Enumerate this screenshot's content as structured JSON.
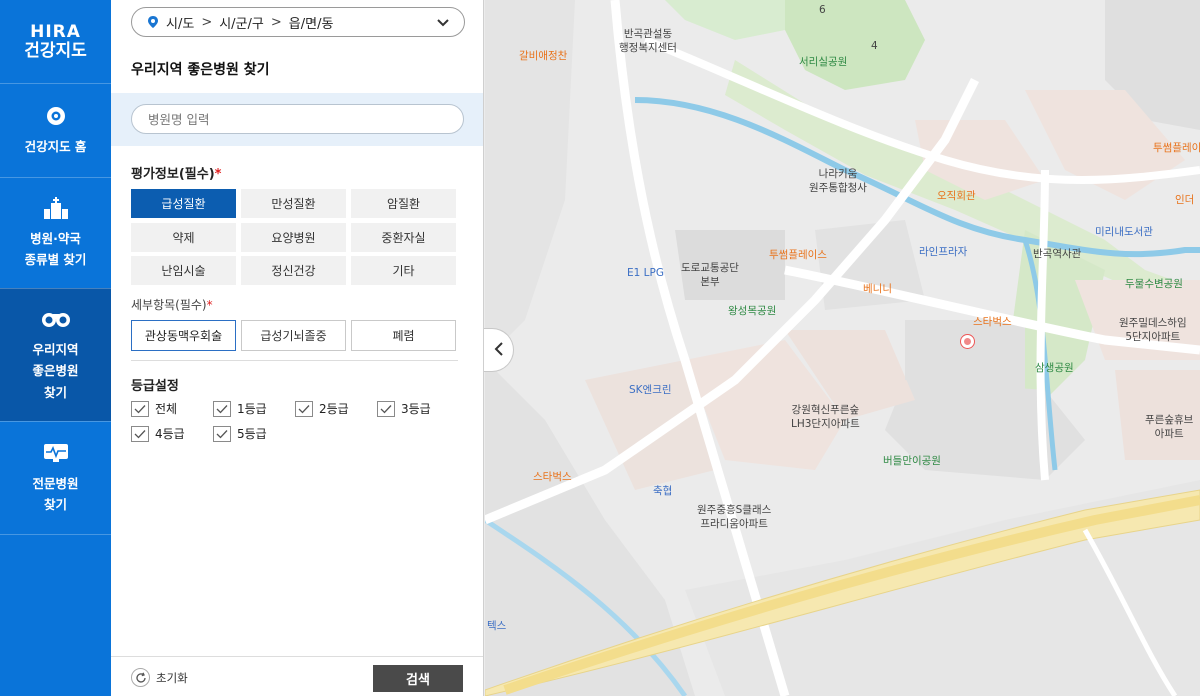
{
  "nav": {
    "logo_line1": "HIRA",
    "logo_line2": "건강지도",
    "items": [
      {
        "label_1": "건강지도 홈",
        "label_2": ""
      },
      {
        "label_1": "병원·약국",
        "label_2": "종류별 찾기"
      },
      {
        "label_1": "우리지역",
        "label_2": "좋은병원",
        "label_3": "찾기"
      },
      {
        "label_1": "전문병원",
        "label_2": "찾기"
      }
    ]
  },
  "region": {
    "sido": "시/도",
    "sigungu": "시/군/구",
    "eupmyeondong": "읍/면/동",
    "sep": ">"
  },
  "panel": {
    "title": "우리지역 좋은병원 찾기",
    "search_placeholder": "병원명 입력",
    "eval_label": "평가정보(필수)",
    "required_mark": "*",
    "eval_items": [
      "급성질환",
      "만성질환",
      "암질환",
      "약제",
      "요양병원",
      "중환자실",
      "난임시술",
      "정신건강",
      "기타"
    ],
    "detail_label": "세부항목(필수)",
    "detail_items": [
      "관상동맥우회술",
      "급성기뇌졸중",
      "폐렴"
    ],
    "grade_label": "등급설정",
    "grades": [
      "전체",
      "1등급",
      "2등급",
      "3등급",
      "4등급",
      "5등급"
    ],
    "reset_label": "초기화",
    "search_label": "검색"
  },
  "colors": {
    "nav": "#0a74d9",
    "nav_active": "#0957a8",
    "selected_chip": "#0c5db0",
    "search_btn": "#4a4a4a"
  },
  "map": {
    "labels": [
      "반곡관설동",
      "행정복지센터",
      "갈비애정찬",
      "서리실공원",
      "투썸플레이",
      "나라키움",
      "원주통합청사",
      "오직회관",
      "라인프라자",
      "미리내도서관",
      "반곡역사관",
      "투썸플레이스",
      "도로교통공단",
      "본부",
      "E1 LPG",
      "베니니",
      "두물수변공원",
      "왕성목공원",
      "스타벅스",
      "원주밀데스하임",
      "5단지아파트",
      "SK엔크린",
      "삼생공원",
      "강원혁신푸른숲",
      "LH3단지아파트",
      "푸른숲휴브",
      "아파트",
      "버들만이공원",
      "스타벅스",
      "축협",
      "원주중흥S클래스",
      "프라디움아파트",
      "텍스",
      "인더",
      "4",
      "6"
    ]
  }
}
